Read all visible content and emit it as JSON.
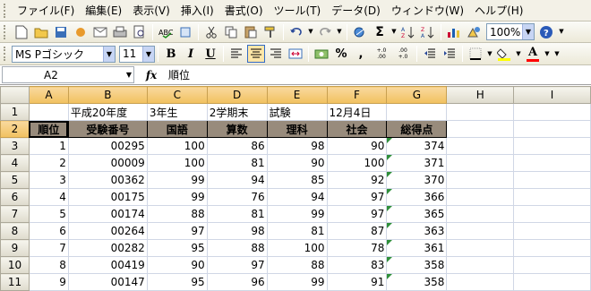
{
  "menu": [
    "ファイル(F)",
    "編集(E)",
    "表示(V)",
    "挿入(I)",
    "書式(O)",
    "ツール(T)",
    "データ(D)",
    "ウィンドウ(W)",
    "ヘルプ(H)"
  ],
  "toolbar": {
    "zoom": "100%",
    "sum_label": "Σ",
    "font_name": "MS Pゴシック",
    "font_size": "11",
    "bold_label": "B",
    "italic_label": "I",
    "underline_label": "U",
    "percent_label": "%",
    "comma_label": ",",
    "inc_dec_label": "+.0 .00",
    "dec_dec_label": ".00 +.0",
    "font_color_label": "A",
    "help_label": "?"
  },
  "formula_bar": {
    "name_box": "A2",
    "fx_label": "fx",
    "content": "順位"
  },
  "columns": [
    "A",
    "B",
    "C",
    "D",
    "E",
    "F",
    "G",
    "H",
    "I"
  ],
  "title_row": {
    "row": "1",
    "b": "平成20年度",
    "c": "3年生",
    "d": "2学期末",
    "e": "試験",
    "f": "12月4日"
  },
  "header_row": {
    "row": "2",
    "cells": [
      "順位",
      "受験番号",
      "国語",
      "算数",
      "理科",
      "社会",
      "総得点"
    ]
  },
  "rows": [
    {
      "row": "3",
      "cells": [
        "1",
        "00295",
        "100",
        "86",
        "98",
        "90",
        "374"
      ]
    },
    {
      "row": "4",
      "cells": [
        "2",
        "00009",
        "100",
        "81",
        "90",
        "100",
        "371"
      ]
    },
    {
      "row": "5",
      "cells": [
        "3",
        "00362",
        "99",
        "94",
        "85",
        "92",
        "370"
      ]
    },
    {
      "row": "6",
      "cells": [
        "4",
        "00175",
        "99",
        "76",
        "94",
        "97",
        "366"
      ]
    },
    {
      "row": "7",
      "cells": [
        "5",
        "00174",
        "88",
        "81",
        "99",
        "97",
        "365"
      ]
    },
    {
      "row": "8",
      "cells": [
        "6",
        "00264",
        "97",
        "98",
        "81",
        "87",
        "363"
      ]
    },
    {
      "row": "9",
      "cells": [
        "7",
        "00282",
        "95",
        "88",
        "100",
        "78",
        "361"
      ]
    },
    {
      "row": "10",
      "cells": [
        "8",
        "00419",
        "90",
        "97",
        "88",
        "83",
        "358"
      ]
    },
    {
      "row": "11",
      "cells": [
        "9",
        "00147",
        "95",
        "96",
        "99",
        "91",
        "358"
      ]
    }
  ]
}
